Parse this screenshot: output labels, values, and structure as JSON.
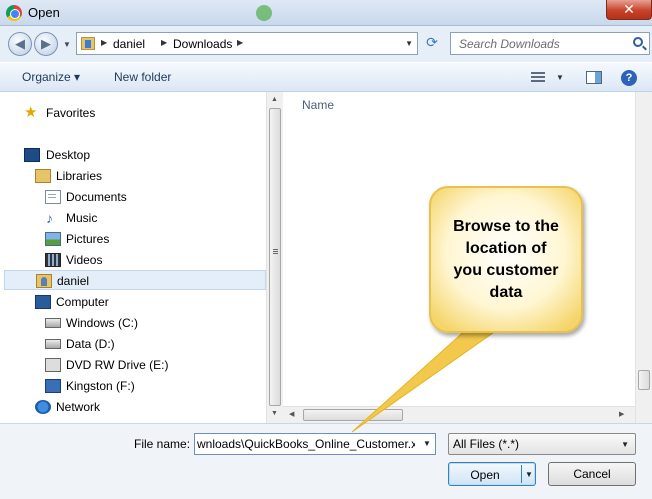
{
  "window": {
    "title": "Open"
  },
  "address": {
    "crumbs": [
      "daniel",
      "Downloads"
    ],
    "search_placeholder": "Search Downloads"
  },
  "toolbar": {
    "organize_label": "Organize ▾",
    "new_folder_label": "New folder"
  },
  "nav": {
    "favorites": "Favorites",
    "desktop": "Desktop",
    "libraries": "Libraries",
    "documents": "Documents",
    "music": "Music",
    "pictures": "Pictures",
    "videos": "Videos",
    "daniel": "daniel",
    "computer": "Computer",
    "windows_c": "Windows (C:)",
    "data_d": "Data (D:)",
    "dvd_e": "DVD RW Drive (E:)",
    "kingston_f": "Kingston (F:)",
    "network": "Network"
  },
  "filelist": {
    "name_header": "Name"
  },
  "callout": {
    "line1": "Browse to the",
    "line2": "location of",
    "line3": "you customer",
    "line4": "data"
  },
  "bottom": {
    "filename_label": "File name:",
    "filename_value": "wnloads\\QuickBooks_Online_Customer.xls",
    "filetype_value": "All Files (*.*)",
    "open_label": "Open",
    "cancel_label": "Cancel"
  },
  "icons": {
    "app": "chrome-icon",
    "back": "back-arrow-icon",
    "forward": "forward-arrow-icon",
    "refresh": "refresh-icon",
    "search": "search-icon",
    "help": "help-icon"
  }
}
